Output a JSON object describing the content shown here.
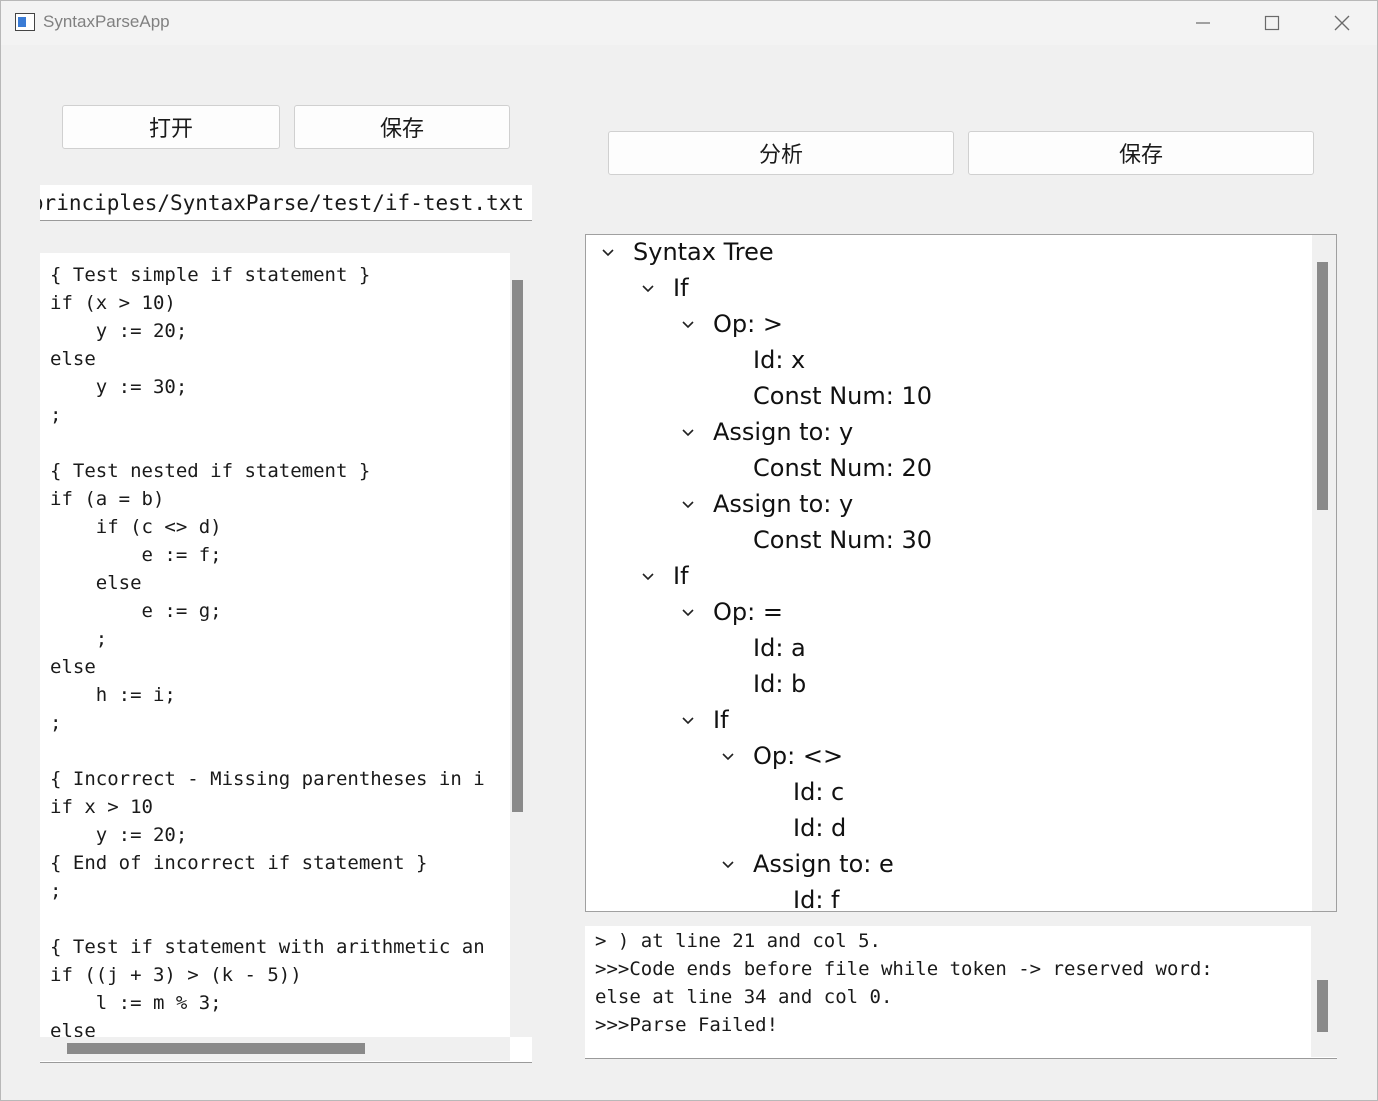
{
  "window": {
    "title": "SyntaxParseApp"
  },
  "left_toolbar": {
    "open_label": "打开",
    "save_label": "保存"
  },
  "right_toolbar": {
    "analyze_label": "分析",
    "save_label": "保存"
  },
  "path_field": {
    "value": "compiler_principles/SyntaxParse/test/if-test.txt"
  },
  "code_lines": [
    "{ Test simple if statement }",
    "if (x > 10)",
    "    y := 20;",
    "else",
    "    y := 30;",
    ";",
    "",
    "{ Test nested if statement }",
    "if (a = b)",
    "    if (c <> d)",
    "        e := f;",
    "    else",
    "        e := g;",
    "    ;",
    "else",
    "    h := i;",
    ";",
    "",
    "{ Incorrect - Missing parentheses in i",
    "if x > 10",
    "    y := 20;",
    "{ End of incorrect if statement }",
    ";",
    "",
    "{ Test if statement with arithmetic an",
    "if ((j + 3) > (k - 5))",
    "    l := m % 3;",
    "else"
  ],
  "tree": [
    {
      "label": "Syntax Tree",
      "level": 0,
      "expanded": true
    },
    {
      "label": "If",
      "level": 1,
      "expanded": true
    },
    {
      "label": "Op: >",
      "level": 2,
      "expanded": true
    },
    {
      "label": "Id: x",
      "level": 3,
      "expanded": false
    },
    {
      "label": "Const Num: 10",
      "level": 3,
      "expanded": false
    },
    {
      "label": "Assign to: y",
      "level": 2,
      "expanded": true
    },
    {
      "label": "Const Num: 20",
      "level": 3,
      "expanded": false
    },
    {
      "label": "Assign to: y",
      "level": 2,
      "expanded": true
    },
    {
      "label": "Const Num: 30",
      "level": 3,
      "expanded": false
    },
    {
      "label": "If",
      "level": 1,
      "expanded": true
    },
    {
      "label": "Op: =",
      "level": 2,
      "expanded": true
    },
    {
      "label": "Id: a",
      "level": 3,
      "expanded": false
    },
    {
      "label": "Id: b",
      "level": 3,
      "expanded": false
    },
    {
      "label": "If",
      "level": 2,
      "expanded": true
    },
    {
      "label": "Op: <>",
      "level": 3,
      "expanded": true
    },
    {
      "label": "Id: c",
      "level": 4,
      "expanded": false
    },
    {
      "label": "Id: d",
      "level": 4,
      "expanded": false
    },
    {
      "label": "Assign to: e",
      "level": 3,
      "expanded": true
    },
    {
      "label": "Id: f",
      "level": 4,
      "expanded": false
    }
  ],
  "log_lines": [
    "> ) at line 21 and col 5.",
    ">>>Code ends before file while token -> reserved word:",
    "else at line 34 and col 0.",
    ">>>Parse Failed!"
  ],
  "icons": {
    "app": "app-window-icon",
    "minimize": "minimize-icon",
    "maximize": "maximize-icon",
    "close": "close-icon",
    "expand": "chevron-down-icon"
  }
}
